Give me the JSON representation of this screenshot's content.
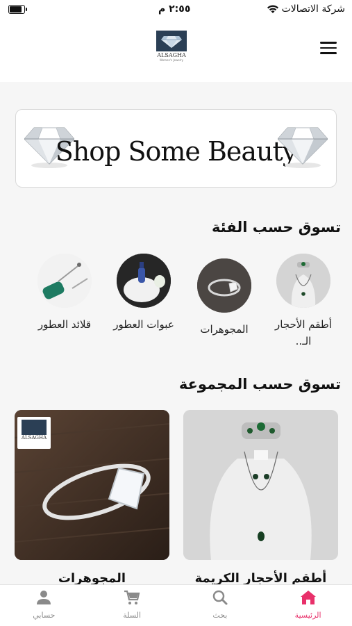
{
  "status": {
    "carrier": "شركة الاتصالات",
    "time": "٢:٥٥ م"
  },
  "header": {
    "logo_text": "ALSAGHA",
    "logo_subtext": "Women's Jewelry",
    "menu_icon": "hamburger-icon"
  },
  "banner": {
    "text": "Shop Some Beauty"
  },
  "categories": {
    "title": "تسوق حسب الفئة",
    "items": [
      {
        "label": "أطقم الأحجار الـ..",
        "image": "necklace-set"
      },
      {
        "label": "المجوهرات",
        "image": "ring"
      },
      {
        "label": "عبوات العطور",
        "image": "perfume-bottle"
      },
      {
        "label": "قلائد العطور",
        "image": "perfume-necklace"
      }
    ]
  },
  "collections": {
    "title": "تسوق حسب المجموعة",
    "items": [
      {
        "label": "أطقم الأحجار الكريمة",
        "image": "gemstone-set"
      },
      {
        "label": "المجوهرات",
        "image": "ring"
      }
    ]
  },
  "tabs": [
    {
      "label": "الرئيسية",
      "icon": "home-icon",
      "active": true
    },
    {
      "label": "بحث",
      "icon": "search-icon",
      "active": false
    },
    {
      "label": "السلة",
      "icon": "cart-icon",
      "active": false
    },
    {
      "label": "حسابي",
      "icon": "person-icon",
      "active": false
    }
  ],
  "colors": {
    "accent": "#e8306a",
    "inactive_tab": "#8a8a8a",
    "background": "#f6f6f6"
  }
}
